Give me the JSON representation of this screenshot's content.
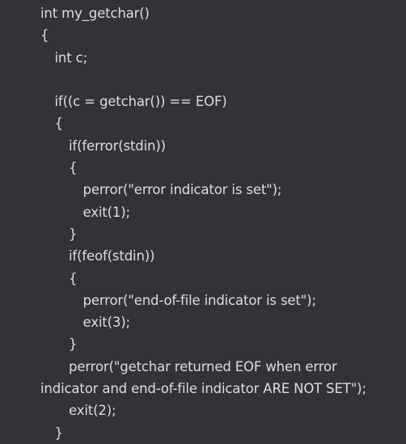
{
  "code": {
    "lines": [
      {
        "text": "int my_getchar()",
        "indent": 0
      },
      {
        "text": "{",
        "indent": 0
      },
      {
        "text": "int c;",
        "indent": 1
      },
      {
        "text": "",
        "indent": 0
      },
      {
        "text": "if((c = getchar()) == EOF)",
        "indent": 1
      },
      {
        "text": "{",
        "indent": 1
      },
      {
        "text": "if(ferror(stdin))",
        "indent": 2
      },
      {
        "text": "{",
        "indent": 2
      },
      {
        "text": "perror(\"error indicator is set\");",
        "indent": 3
      },
      {
        "text": "exit(1);",
        "indent": 3
      },
      {
        "text": "}",
        "indent": 2
      },
      {
        "text": "if(feof(stdin))",
        "indent": 2
      },
      {
        "text": "{",
        "indent": 2
      },
      {
        "text": "perror(\"end-of-file indicator is set\");",
        "indent": 3
      },
      {
        "text": "exit(3);",
        "indent": 3
      },
      {
        "text": "}",
        "indent": 2
      },
      {
        "text": "perror(\"getchar returned EOF when error",
        "indent": 2
      },
      {
        "text": "indicator and end-of-file indicator ARE NOT SET\");",
        "indent": 0
      },
      {
        "text": "exit(2);",
        "indent": 2
      },
      {
        "text": "}",
        "indent": 1
      }
    ]
  }
}
